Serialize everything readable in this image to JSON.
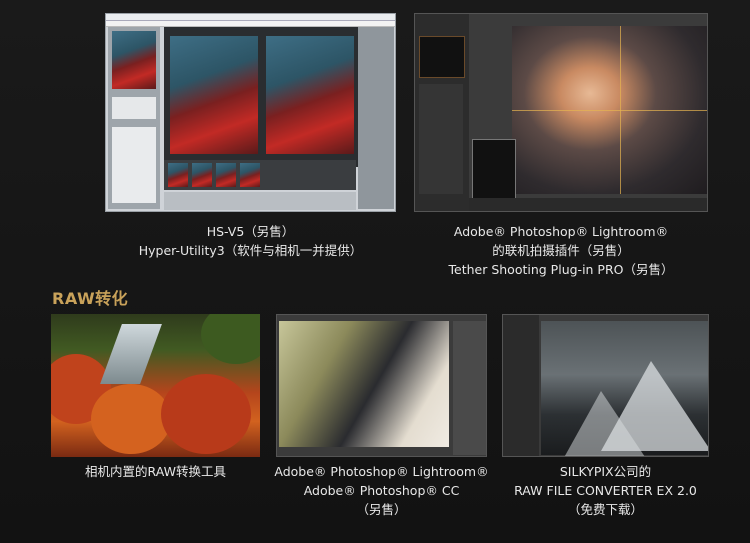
{
  "items": [
    {
      "name": "hs-v5",
      "lines": [
        "HS-V5（另售）",
        "Hyper-Utility3（软件与相机一并提供）"
      ]
    },
    {
      "name": "lightroom-tether",
      "lines": [
        "Adobe® Photoshop® Lightroom®",
        "的联机拍摄插件（另售）",
        "Tether Shooting Plug-in PRO（另售）"
      ]
    }
  ],
  "section": {
    "title": "RAW转化"
  },
  "raw_items": [
    {
      "name": "in-camera-raw",
      "lines": [
        "相机内置的RAW转换工具"
      ]
    },
    {
      "name": "adobe-raw",
      "lines": [
        "Adobe® Photoshop® Lightroom®",
        "Adobe® Photoshop® CC",
        "（另售）"
      ]
    },
    {
      "name": "silkypix",
      "lines": [
        "SILKYPIX公司的",
        "RAW FILE CONVERTER EX 2.0",
        "（免费下载）"
      ]
    }
  ],
  "colors": {
    "background": "#151515",
    "accent": "#c9a25a",
    "text": "#e8e8e8"
  }
}
